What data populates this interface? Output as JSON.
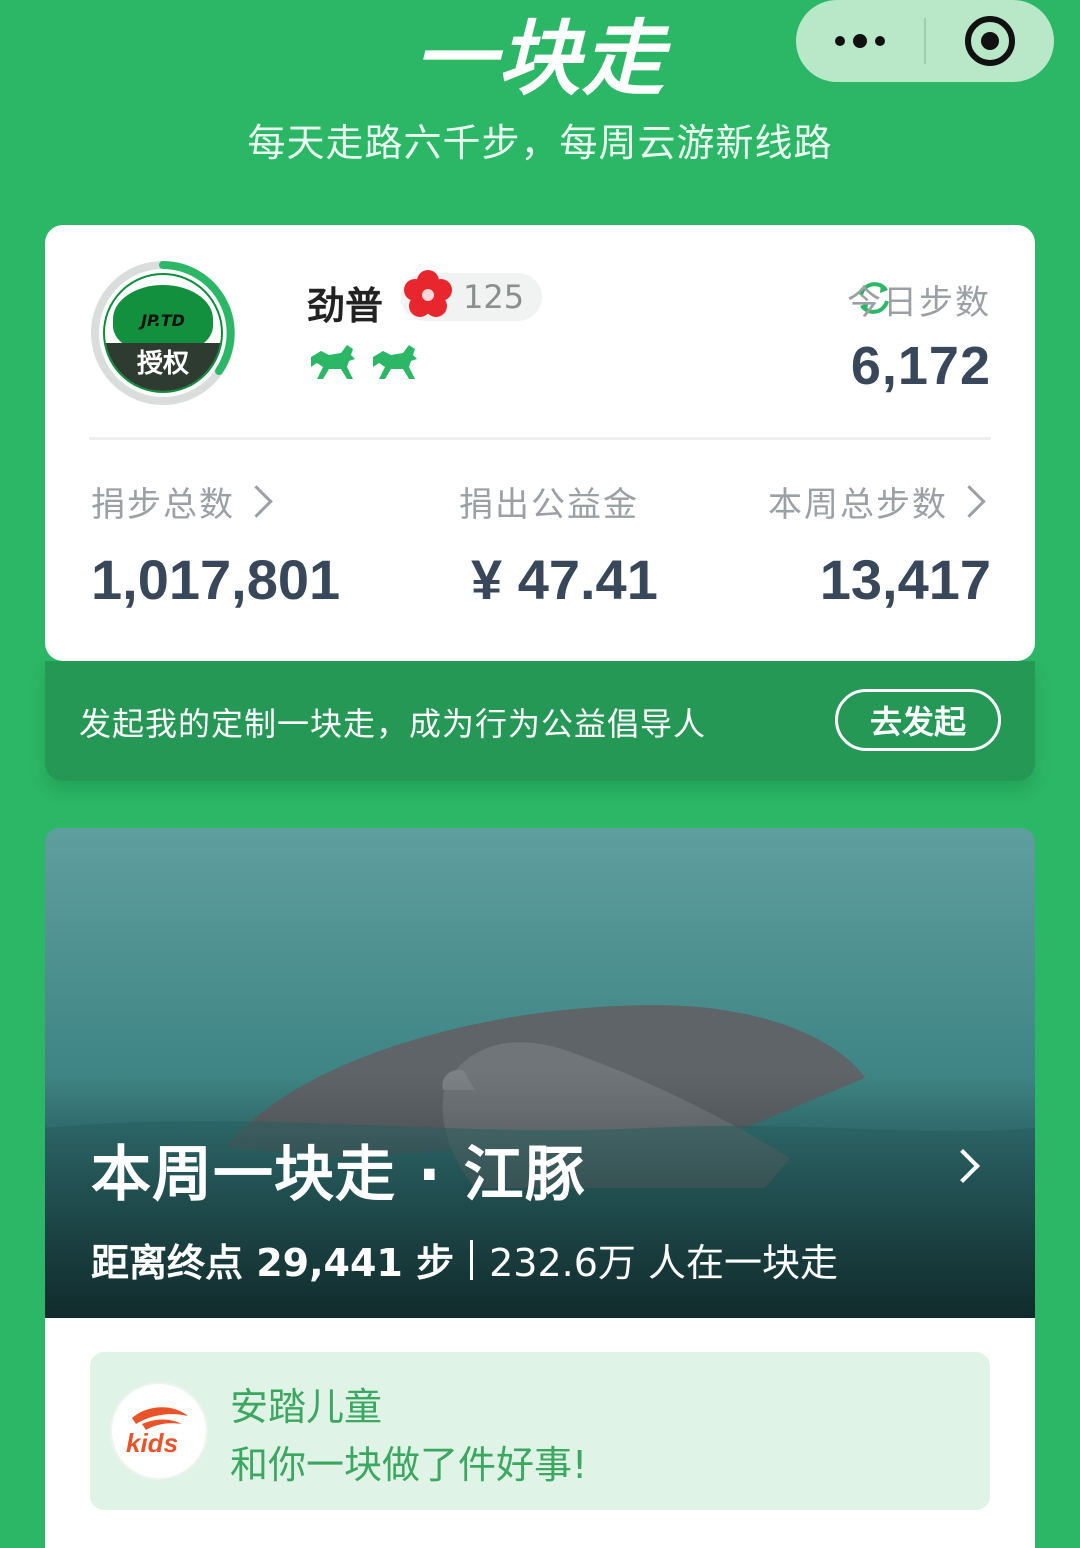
{
  "header": {
    "app_title": "一块走",
    "slogan": "每天走路六千步，每周云游新线路"
  },
  "capsule": {
    "more_icon": "more-dots-icon",
    "close_icon": "target-close-icon"
  },
  "profile": {
    "avatar_brand": "JP.TD",
    "avatar_badge": "授权",
    "username": "劲普",
    "flower_count": "125",
    "today_steps_label": "今日步数",
    "today_steps": "6,172",
    "horse_icon_count": 2
  },
  "stats": [
    {
      "label": "捐步总数",
      "value": "1,017,801",
      "has_arrow": true
    },
    {
      "label": "捐出公益金",
      "value": "¥ 47.41",
      "has_arrow": false
    },
    {
      "label": "本周总步数",
      "value": "13,417",
      "has_arrow": true
    }
  ],
  "banner": {
    "text": "发起我的定制一块走，成为行为公益倡导人",
    "button": "去发起"
  },
  "weekly": {
    "title": "本周一块走 · 江豚",
    "distance_label": "距离终点 29,441 步",
    "participants": "232.6万 人在一块走"
  },
  "sponsor": {
    "logo_text": "kids",
    "name": "安踏儿童",
    "message": "和你一块做了件好事!"
  },
  "colors": {
    "brand_green": "#2bb766",
    "dark_green": "#259856",
    "number_color": "#38485a",
    "sponsor_bg": "#dff3e6"
  }
}
